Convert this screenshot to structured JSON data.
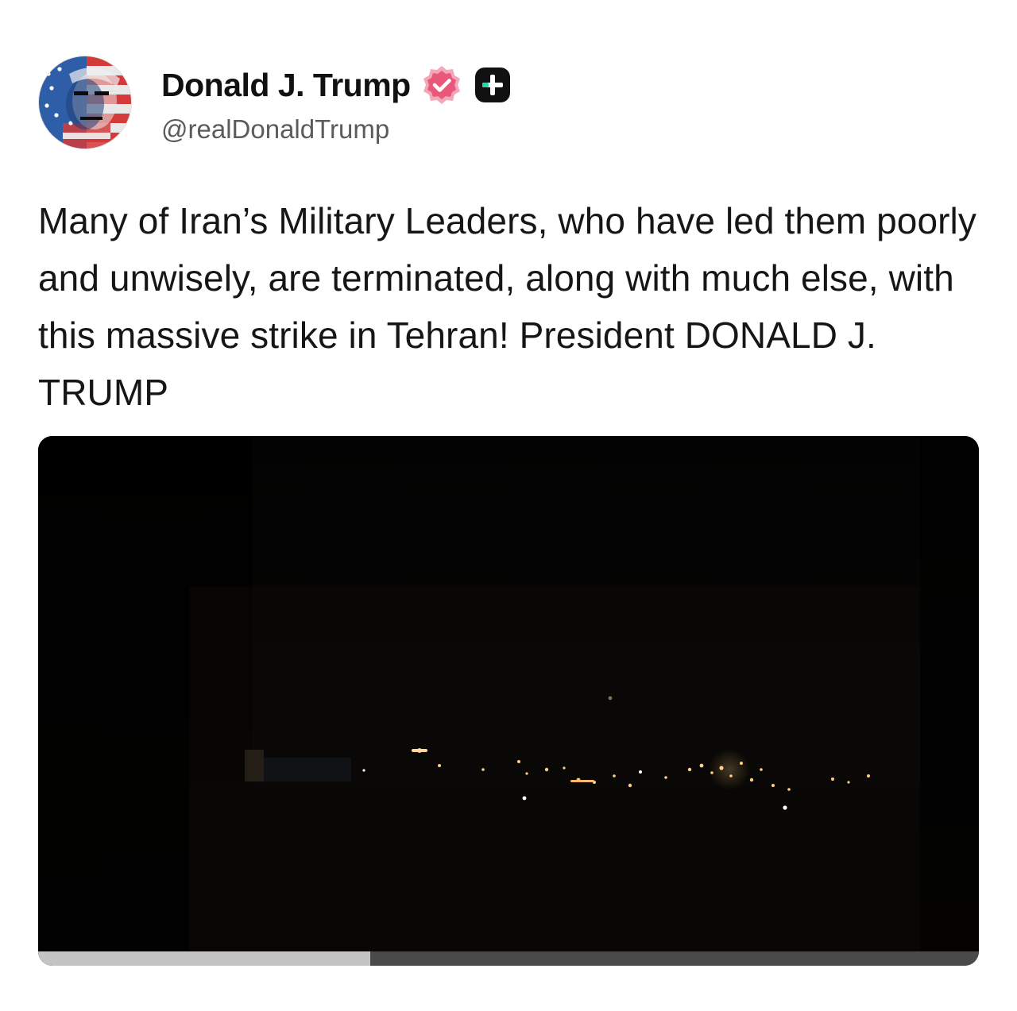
{
  "author": {
    "display_name": "Donald J. Trump",
    "handle": "@realDonaldTrump",
    "avatar_icon": "avatar-flag-portrait",
    "verified_icon": "verified-badge-icon",
    "verified_color": "#e8587a",
    "plus_badge_icon": "plus-badge-icon",
    "plus_badge_color": "#111111",
    "plus_badge_accent": "#2fd3a7"
  },
  "post": {
    "text": "Many of Iran’s Military Leaders, who have led them poorly and unwisely, are terminated, along with much else, with this massive strike in Tehran! President DONALD J. TRUMP"
  },
  "media": {
    "type": "video",
    "progress": 0.353,
    "colors": {
      "played": "#c4c4c4",
      "remaining": "#4a4a4a",
      "background": "#050505"
    }
  }
}
